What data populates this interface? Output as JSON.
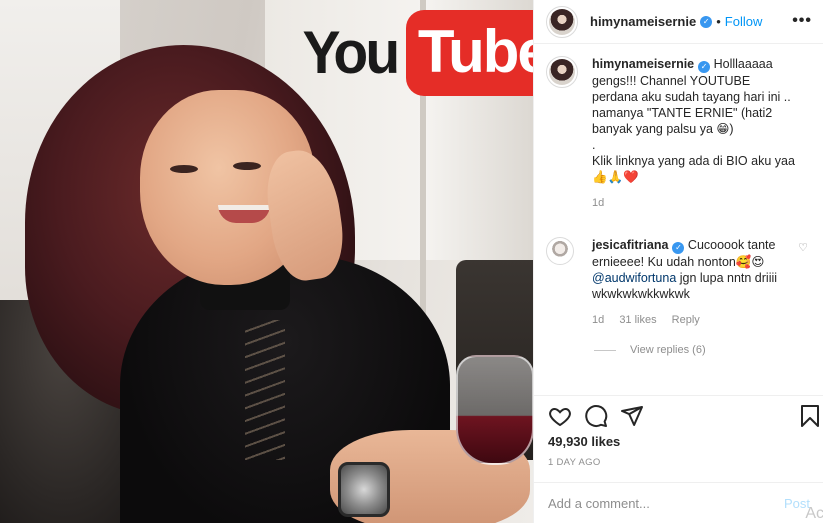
{
  "photo": {
    "logo": {
      "you": "You",
      "tube": "Tube"
    }
  },
  "header": {
    "username": "himynameisernie",
    "separator": "•",
    "follow_label": "Follow",
    "more_label": "•••"
  },
  "caption": {
    "username": "himynameisernie",
    "lines": [
      "Holllaaaaa gengs!!! Channel YOUTUBE perdana aku sudah tayang hari ini .. namanya \"TANTE ERNIE\" (hati2 banyak yang palsu ya 😁)",
      ".",
      "Klik linknya yang ada di BIO aku yaa 👍🙏❤️"
    ],
    "age": "1d"
  },
  "comment": {
    "username": "jesicafitriana",
    "text_start": "Cucooook tante ernieeee! Ku udah nonton🥰😍",
    "mention": "@audwifortuna",
    "text_end": "jgn lupa nntn driiii wkwkwkwkkwkwk",
    "age": "1d",
    "likes": "31 likes",
    "reply_label": "Reply",
    "view_replies": "View replies (6)"
  },
  "actions": {
    "icons": [
      "heart-icon",
      "comment-icon",
      "share-icon",
      "bookmark-icon"
    ]
  },
  "stats": {
    "likes": "49,930 likes",
    "date": "1 DAY AGO"
  },
  "add_comment": {
    "placeholder": "Add a comment...",
    "post_label": "Post",
    "overlay_text": "Ac"
  },
  "colors": {
    "link": "#0095f6",
    "verified": "#3897f0",
    "youtube_red": "#e52d27"
  }
}
